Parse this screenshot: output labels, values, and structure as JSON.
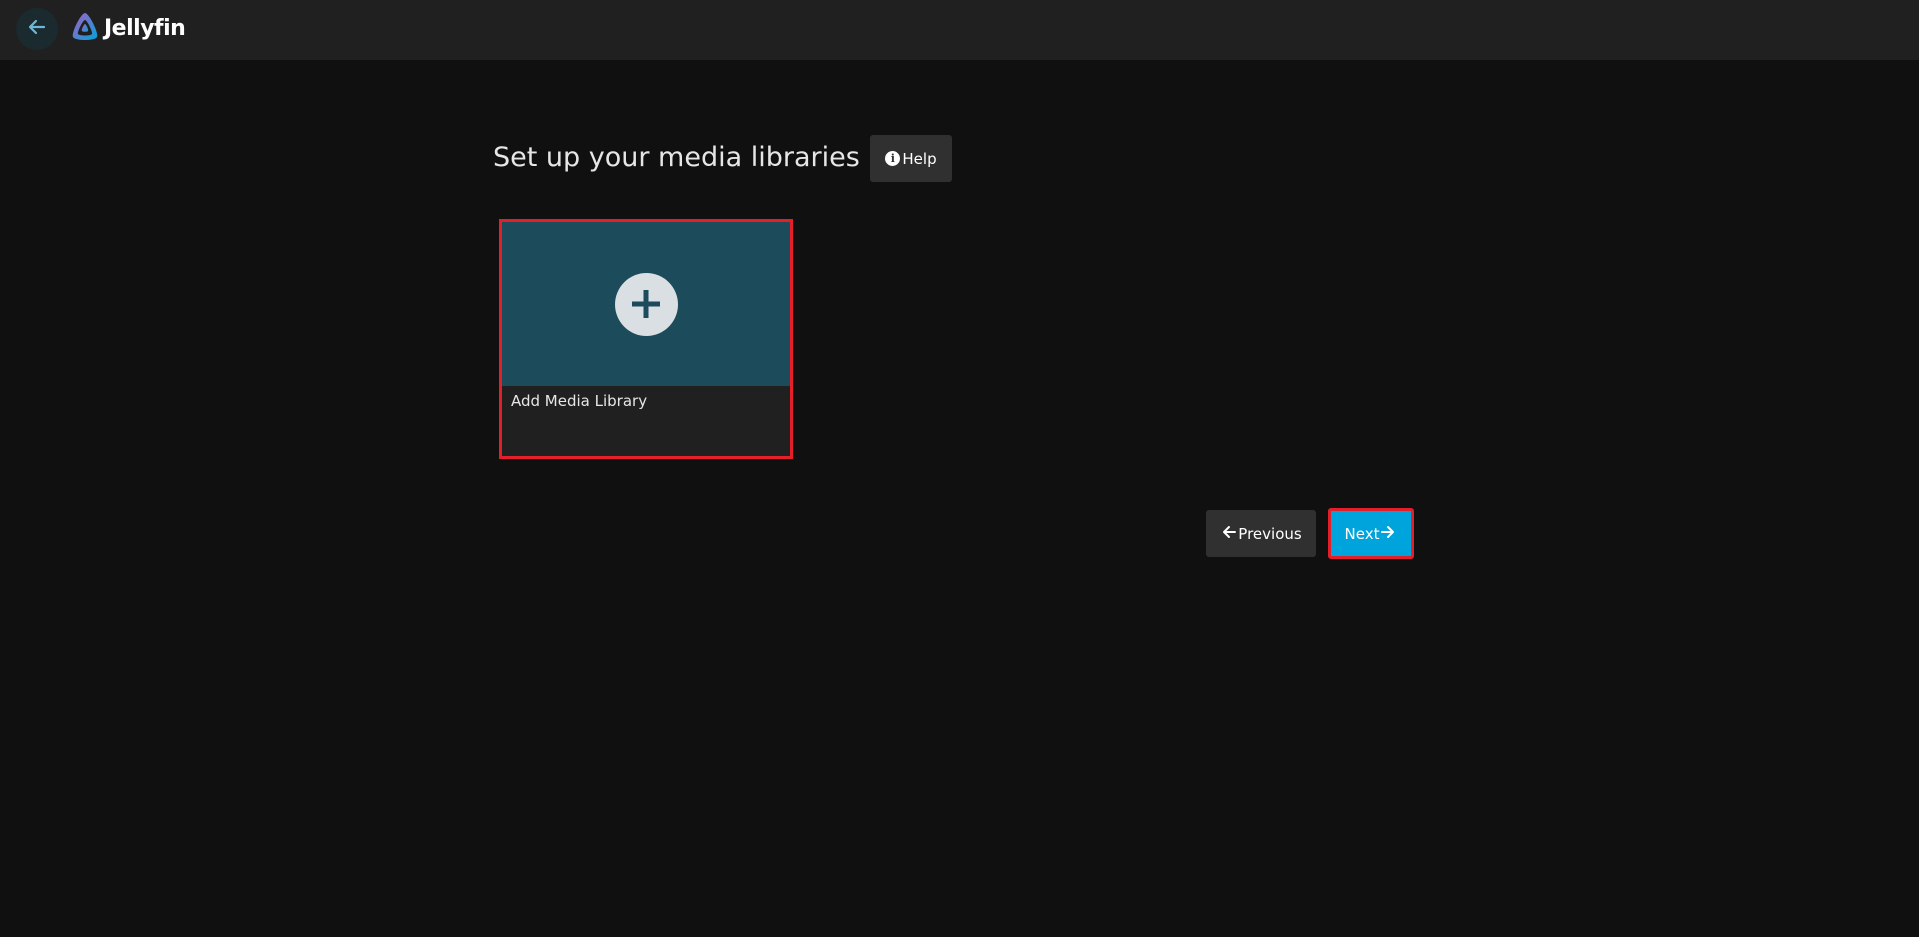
{
  "header": {
    "app_name": "Jellyfin",
    "back_icon": "arrow-left-icon",
    "logo_icon": "jellyfin-logo-icon"
  },
  "main": {
    "title": "Set up your media libraries",
    "help_label": "Help",
    "add_library_card": {
      "label": "Add Media Library",
      "icon": "plus-icon"
    }
  },
  "footer_nav": {
    "previous_label": "Previous",
    "next_label": "Next"
  },
  "colors": {
    "accent": "#00a4dc",
    "card_image": "#1c4b5c",
    "highlight_border": "#e3202a",
    "topbar": "#202020",
    "background": "#101010"
  }
}
